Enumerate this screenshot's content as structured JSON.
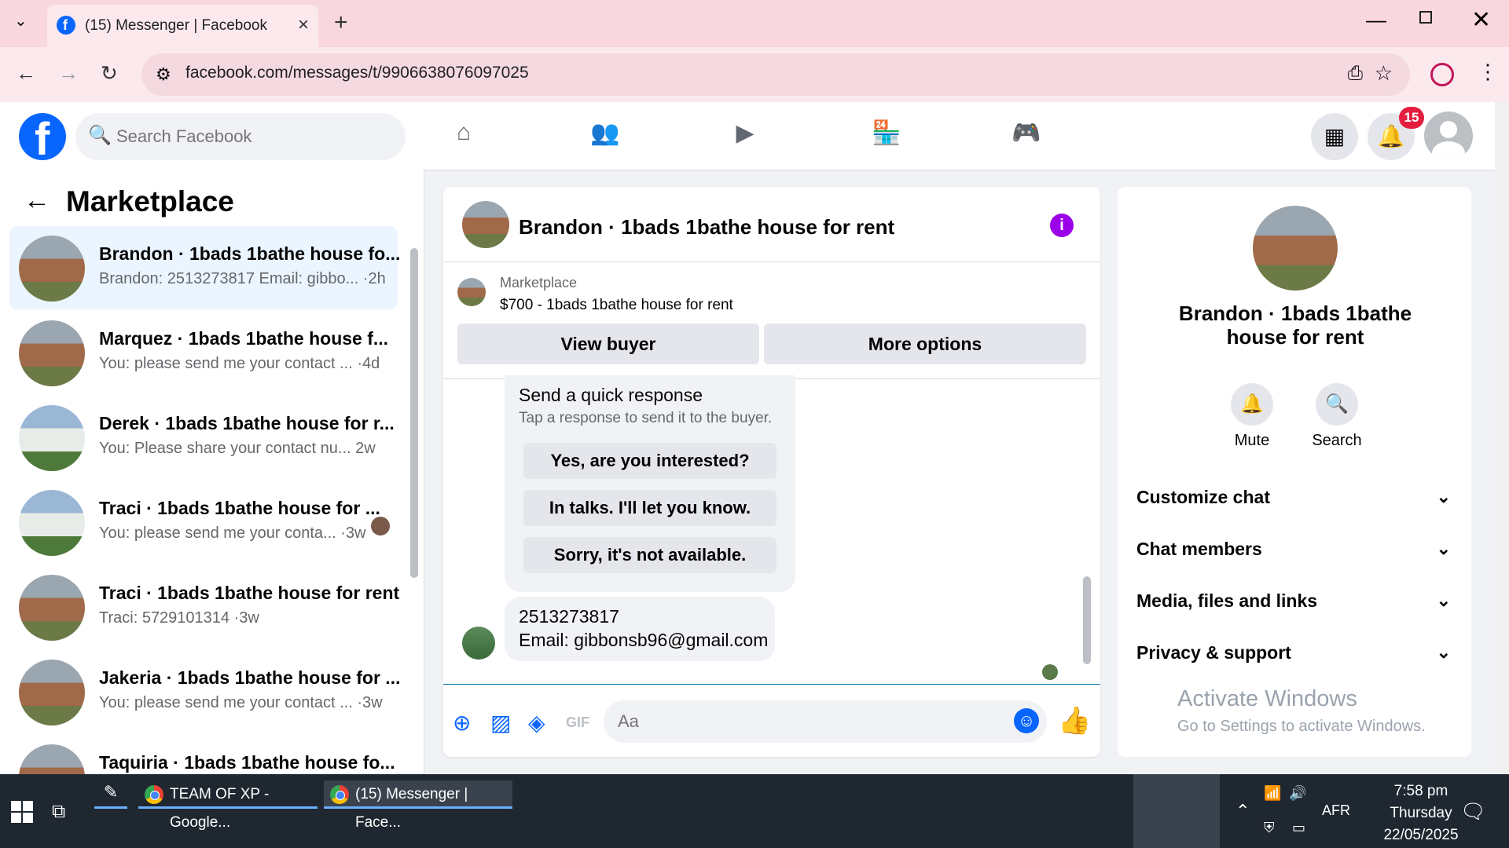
{
  "browser": {
    "tab_title": "(15) Messenger | Facebook",
    "new_tab": "+",
    "url": "facebook.com/messages/t/9906638076097025"
  },
  "fb": {
    "search_placeholder": "Search Facebook",
    "notification_count": "15"
  },
  "left_panel": {
    "title": "Marketplace",
    "conversations": [
      {
        "name": "Brandon · 1bads 1bathe house fo...",
        "preview": "Brandon: 2513273817 Email: gibbo... ·2h"
      },
      {
        "name": "Marquez · 1bads 1bathe house f...",
        "preview": "You: please send me your contact ... ·4d"
      },
      {
        "name": "Derek · 1bads 1bathe house for r...",
        "preview": "You: Please share your contact nu...    2w"
      },
      {
        "name": "Traci · 1bads 1bathe house for ...",
        "preview": "You: please send me your conta... ·3w"
      },
      {
        "name": "Traci · 1bads 1bathe house for rent",
        "preview": "Traci: 5729101314 ·3w"
      },
      {
        "name": "Jakeria · 1bads 1bathe house for ...",
        "preview": "You: please send me your contact ... ·3w"
      },
      {
        "name": "Taquiria · 1bads 1bathe house fo...",
        "preview": ""
      }
    ]
  },
  "chat": {
    "title": "Brandon · 1bads 1bathe house for rent",
    "info": "i",
    "marketplace_label": "Marketplace",
    "listing": "$700 - 1bads 1bathe house for rent",
    "view_buyer": "View buyer",
    "more_options": "More options",
    "quick_title": "Send a quick response",
    "quick_sub": "Tap a response to send it to the buyer.",
    "quick_replies": [
      "Yes, are you interested?",
      "In talks. I'll let you know.",
      "Sorry, it's not available."
    ],
    "message_line1": "2513273817",
    "message_line2": "Email: gibbonsb96@gmail.com",
    "composer_placeholder": "Aa"
  },
  "right_panel": {
    "name": "Brandon · 1bads 1bathe house for rent",
    "mute": "Mute",
    "search": "Search",
    "sections": [
      "Customize chat",
      "Chat members",
      "Media, files and links",
      "Privacy & support"
    ],
    "activate_title": "Activate Windows",
    "activate_sub": "Go to Settings to activate Windows."
  },
  "taskbar": {
    "app1": "TEAM OF XP - Google...",
    "app2": "(15) Messenger | Face...",
    "lang": "AFR",
    "time": "7:58 pm",
    "day": "Thursday",
    "date": "22/05/2025"
  }
}
